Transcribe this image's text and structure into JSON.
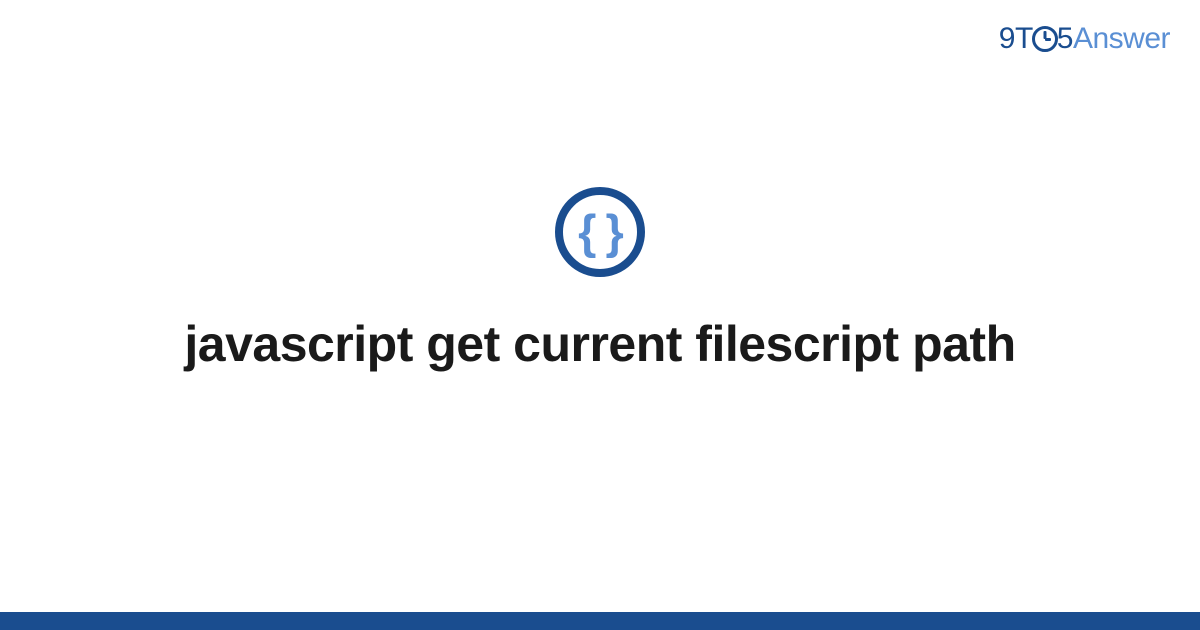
{
  "logo": {
    "part1": "9",
    "part2": "T",
    "part3": "5",
    "part4": "Answer"
  },
  "icon": {
    "braces": "{ }"
  },
  "title": "javascript get current filescript path"
}
